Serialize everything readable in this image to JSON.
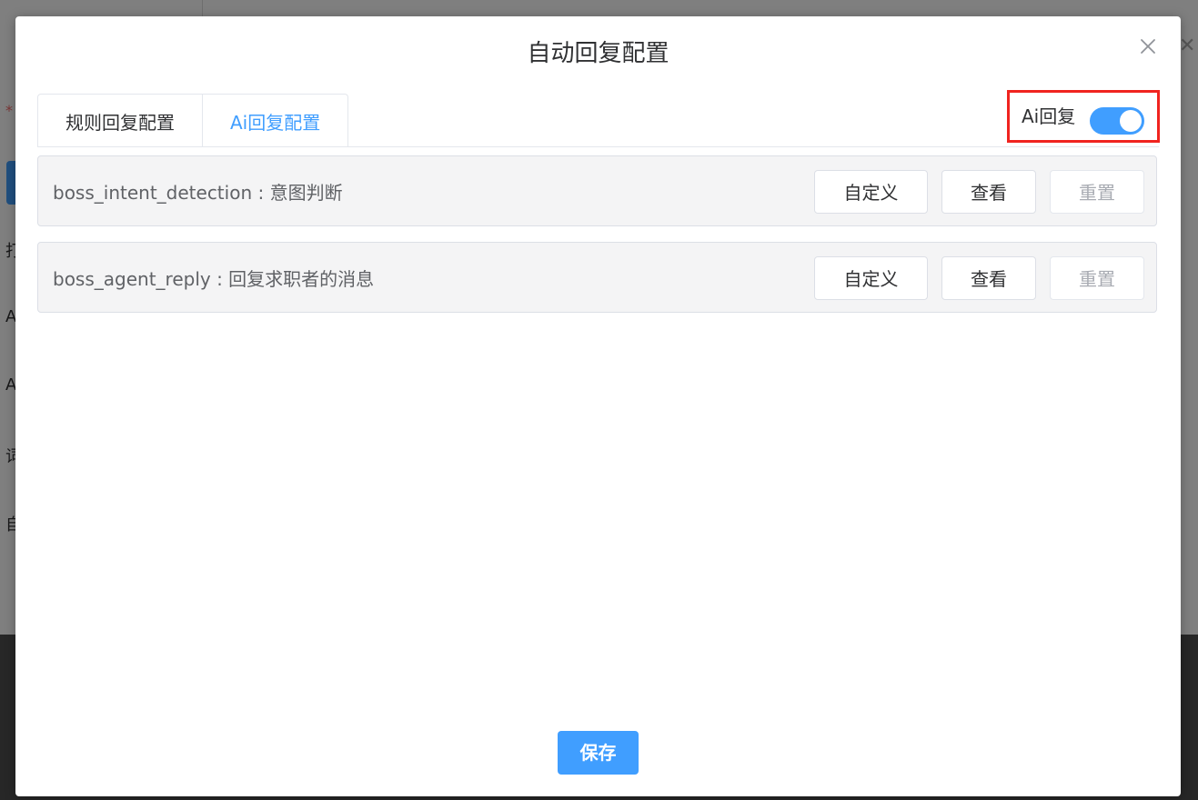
{
  "background": {
    "labels": [
      "打",
      "A",
      "A",
      "词",
      "自"
    ]
  },
  "dialog": {
    "title": "自动回复配置",
    "close_icon": "close-icon",
    "tabs": [
      {
        "label": "规则回复配置",
        "active": false
      },
      {
        "label": "Ai回复配置",
        "active": true
      }
    ],
    "ai_switch": {
      "label": "Ai回复",
      "enabled": true
    },
    "rows": [
      {
        "text": "boss_intent_detection : 意图判断",
        "custom_label": "自定义",
        "view_label": "查看",
        "reset_label": "重置"
      },
      {
        "text": "boss_agent_reply : 回复求职者的消息",
        "custom_label": "自定义",
        "view_label": "查看",
        "reset_label": "重置"
      }
    ],
    "save_label": "保存"
  },
  "colors": {
    "primary": "#409eff",
    "highlight_border": "#f0241f",
    "row_bg": "#f4f4f5"
  }
}
